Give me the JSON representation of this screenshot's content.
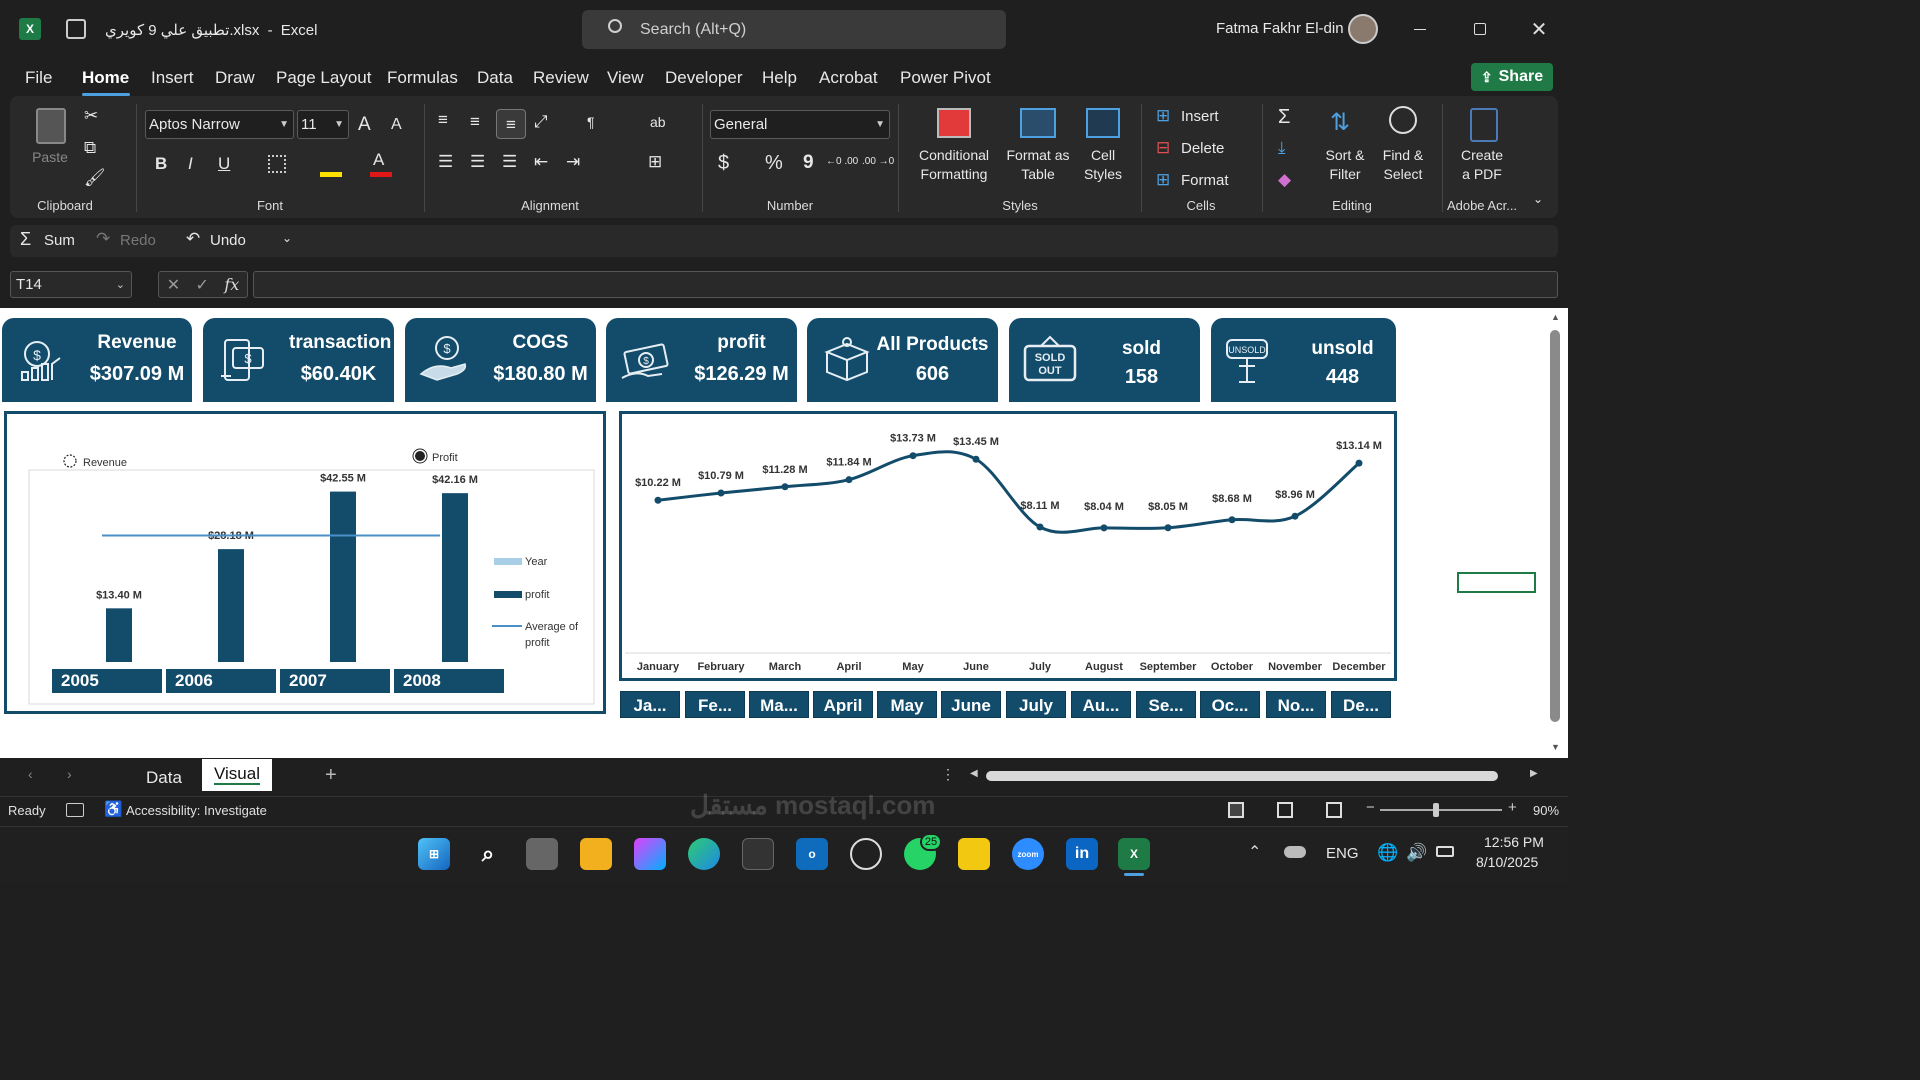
{
  "window": {
    "file_name": "تطبيق علي 9 كويري.xlsx",
    "separator": "-",
    "app_name": "Excel",
    "user_name": "Fatma Fakhr El-din",
    "search_placeholder": "Search (Alt+Q)"
  },
  "menu": [
    "File",
    "Home",
    "Insert",
    "Draw",
    "Page Layout",
    "Formulas",
    "Data",
    "Review",
    "View",
    "Developer",
    "Help",
    "Acrobat",
    "Power Pivot"
  ],
  "share_label": "Share",
  "ribbon": {
    "clipboard": {
      "paste": "Paste",
      "label": "Clipboard"
    },
    "font": {
      "name": "Aptos Narrow",
      "size": "11",
      "label": "Font",
      "bold": "B",
      "italic": "I",
      "underline": "U",
      "grow": "A",
      "shrink": "A",
      "font_color": "A"
    },
    "alignment": {
      "label": "Alignment"
    },
    "number": {
      "format": "General",
      "label": "Number",
      "currency": "$",
      "percent": "%",
      "comma": "9",
      "inc_dec": "←0 .00",
      "dec_dec": ".00 →0"
    },
    "styles": {
      "conditional_1": "Conditional",
      "conditional_2": "Formatting",
      "format_table_1": "Format as",
      "format_table_2": "Table",
      "cell_styles_1": "Cell",
      "cell_styles_2": "Styles",
      "label": "Styles"
    },
    "cells": {
      "insert": "Insert",
      "delete": "Delete",
      "format": "Format",
      "label": "Cells"
    },
    "editing": {
      "sort_1": "Sort &",
      "sort_2": "Filter",
      "find_1": "Find &",
      "find_2": "Select",
      "label": "Editing"
    },
    "adobe": {
      "create_1": "Create",
      "create_2": "a PDF",
      "label": "Adobe Acr..."
    }
  },
  "quick_access": {
    "sum": "Sum",
    "redo": "Redo",
    "undo": "Undo"
  },
  "formula_bar": {
    "name_box": "T14",
    "fx": "fx",
    "value": ""
  },
  "kpis": [
    {
      "title": "Revenue",
      "value": "$307.09 M",
      "icon": "money-growth-icon"
    },
    {
      "title": "transaction",
      "value": "$60.40K",
      "icon": "money-transfer-icon"
    },
    {
      "title": "COGS",
      "value": "$180.80 M",
      "icon": "hand-coin-icon"
    },
    {
      "title": "profit",
      "value": "$126.29 M",
      "icon": "cash-hand-icon"
    },
    {
      "title": "All Products",
      "value": "606",
      "icon": "box-icon"
    },
    {
      "title": "sold",
      "value": "158",
      "icon": "sold-out-sign-icon"
    },
    {
      "title": "unsold",
      "value": "448",
      "icon": "unsold-sign-icon"
    }
  ],
  "chart_data": [
    {
      "type": "bar",
      "categories": [
        "2005",
        "2006",
        "2007",
        "2008"
      ],
      "series": [
        {
          "name": "profit",
          "values": [
            13.4,
            28.18,
            42.55,
            42.16
          ]
        }
      ],
      "data_labels": [
        "$13.40 M",
        "$28.18 M",
        "$42.55 M",
        "$42.16 M"
      ],
      "average_line": 31.57,
      "legend": {
        "top": [
          "Revenue",
          "Profit"
        ],
        "right": [
          "Year",
          "profit",
          "Average of profit"
        ]
      },
      "ylim": [
        0,
        48
      ]
    },
    {
      "type": "line",
      "categories": [
        "January",
        "February",
        "March",
        "April",
        "May",
        "June",
        "July",
        "August",
        "September",
        "October",
        "November",
        "December"
      ],
      "series": [
        {
          "values": [
            10.22,
            10.79,
            11.28,
            11.84,
            13.73,
            13.45,
            8.11,
            8.04,
            8.05,
            8.68,
            8.96,
            13.14
          ]
        }
      ],
      "data_labels": [
        "$10.22 M",
        "$10.79 M",
        "$11.28 M",
        "$11.84 M",
        "$13.73 M",
        "$13.45 M",
        "$8.11 M",
        "$8.04 M",
        "$8.05 M",
        "$8.68 M",
        "$8.96 M",
        "$13.14 M"
      ],
      "ylim": [
        0,
        15
      ]
    }
  ],
  "year_slicer": [
    "2005",
    "2006",
    "2007",
    "2008"
  ],
  "month_slicer": [
    "Ja...",
    "Fe...",
    "Ma...",
    "April",
    "May",
    "June",
    "July",
    "Au...",
    "Se...",
    "Oc...",
    "No...",
    "De..."
  ],
  "sheet_tabs": [
    "Data",
    "Visual"
  ],
  "active_tab": "Visual",
  "status": {
    "ready": "Ready",
    "accessibility": "Accessibility: Investigate",
    "zoom": "90%"
  },
  "taskbar": {
    "language": "ENG",
    "time": "12:56 PM",
    "date": "8/10/2025",
    "whatsapp_badge": "25",
    "watermark": "مستقل mostaql.com"
  },
  "colors": {
    "accent": "#134c6b",
    "excel_green": "#1e7b45",
    "avg_line": "#4a90c8",
    "legend_year": "#a9cfe6"
  }
}
